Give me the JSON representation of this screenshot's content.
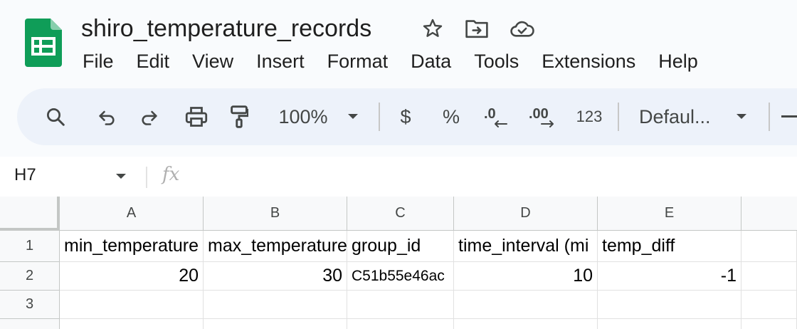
{
  "document": {
    "title": "shiro_temperature_records",
    "title_icons": [
      "star-icon",
      "move-to-folder-icon",
      "cloud-saved-icon"
    ]
  },
  "menu": {
    "items": [
      "File",
      "Edit",
      "View",
      "Insert",
      "Format",
      "Data",
      "Tools",
      "Extensions",
      "Help"
    ]
  },
  "toolbar": {
    "zoom": "100%",
    "currency": "$",
    "percent": "%",
    "number_format": "123",
    "font": "Defaul...",
    "icons": [
      "search-icon",
      "undo-icon",
      "redo-icon",
      "print-icon",
      "paint-format-icon",
      "decrease-decimal-icon",
      "increase-decimal-icon"
    ]
  },
  "formula_bar": {
    "name_box": "H7",
    "fx": "fx"
  },
  "grid": {
    "columns": [
      "A",
      "B",
      "C",
      "D",
      "E"
    ],
    "rows": [
      "1",
      "2",
      "3"
    ],
    "cells": {
      "A1": "min_temperature",
      "B1": "max_temperature",
      "C1": "group_id",
      "D1": "time_interval (mi",
      "E1": "temp_diff",
      "A2": "20",
      "B2": "30",
      "C2": "C51b55e46ac",
      "D2": "10",
      "E2": "-1"
    }
  },
  "colors": {
    "sheets_green": "#0f9d58",
    "toolbar_bg": "#edf2fa",
    "header_bg": "#f8f9fa"
  }
}
